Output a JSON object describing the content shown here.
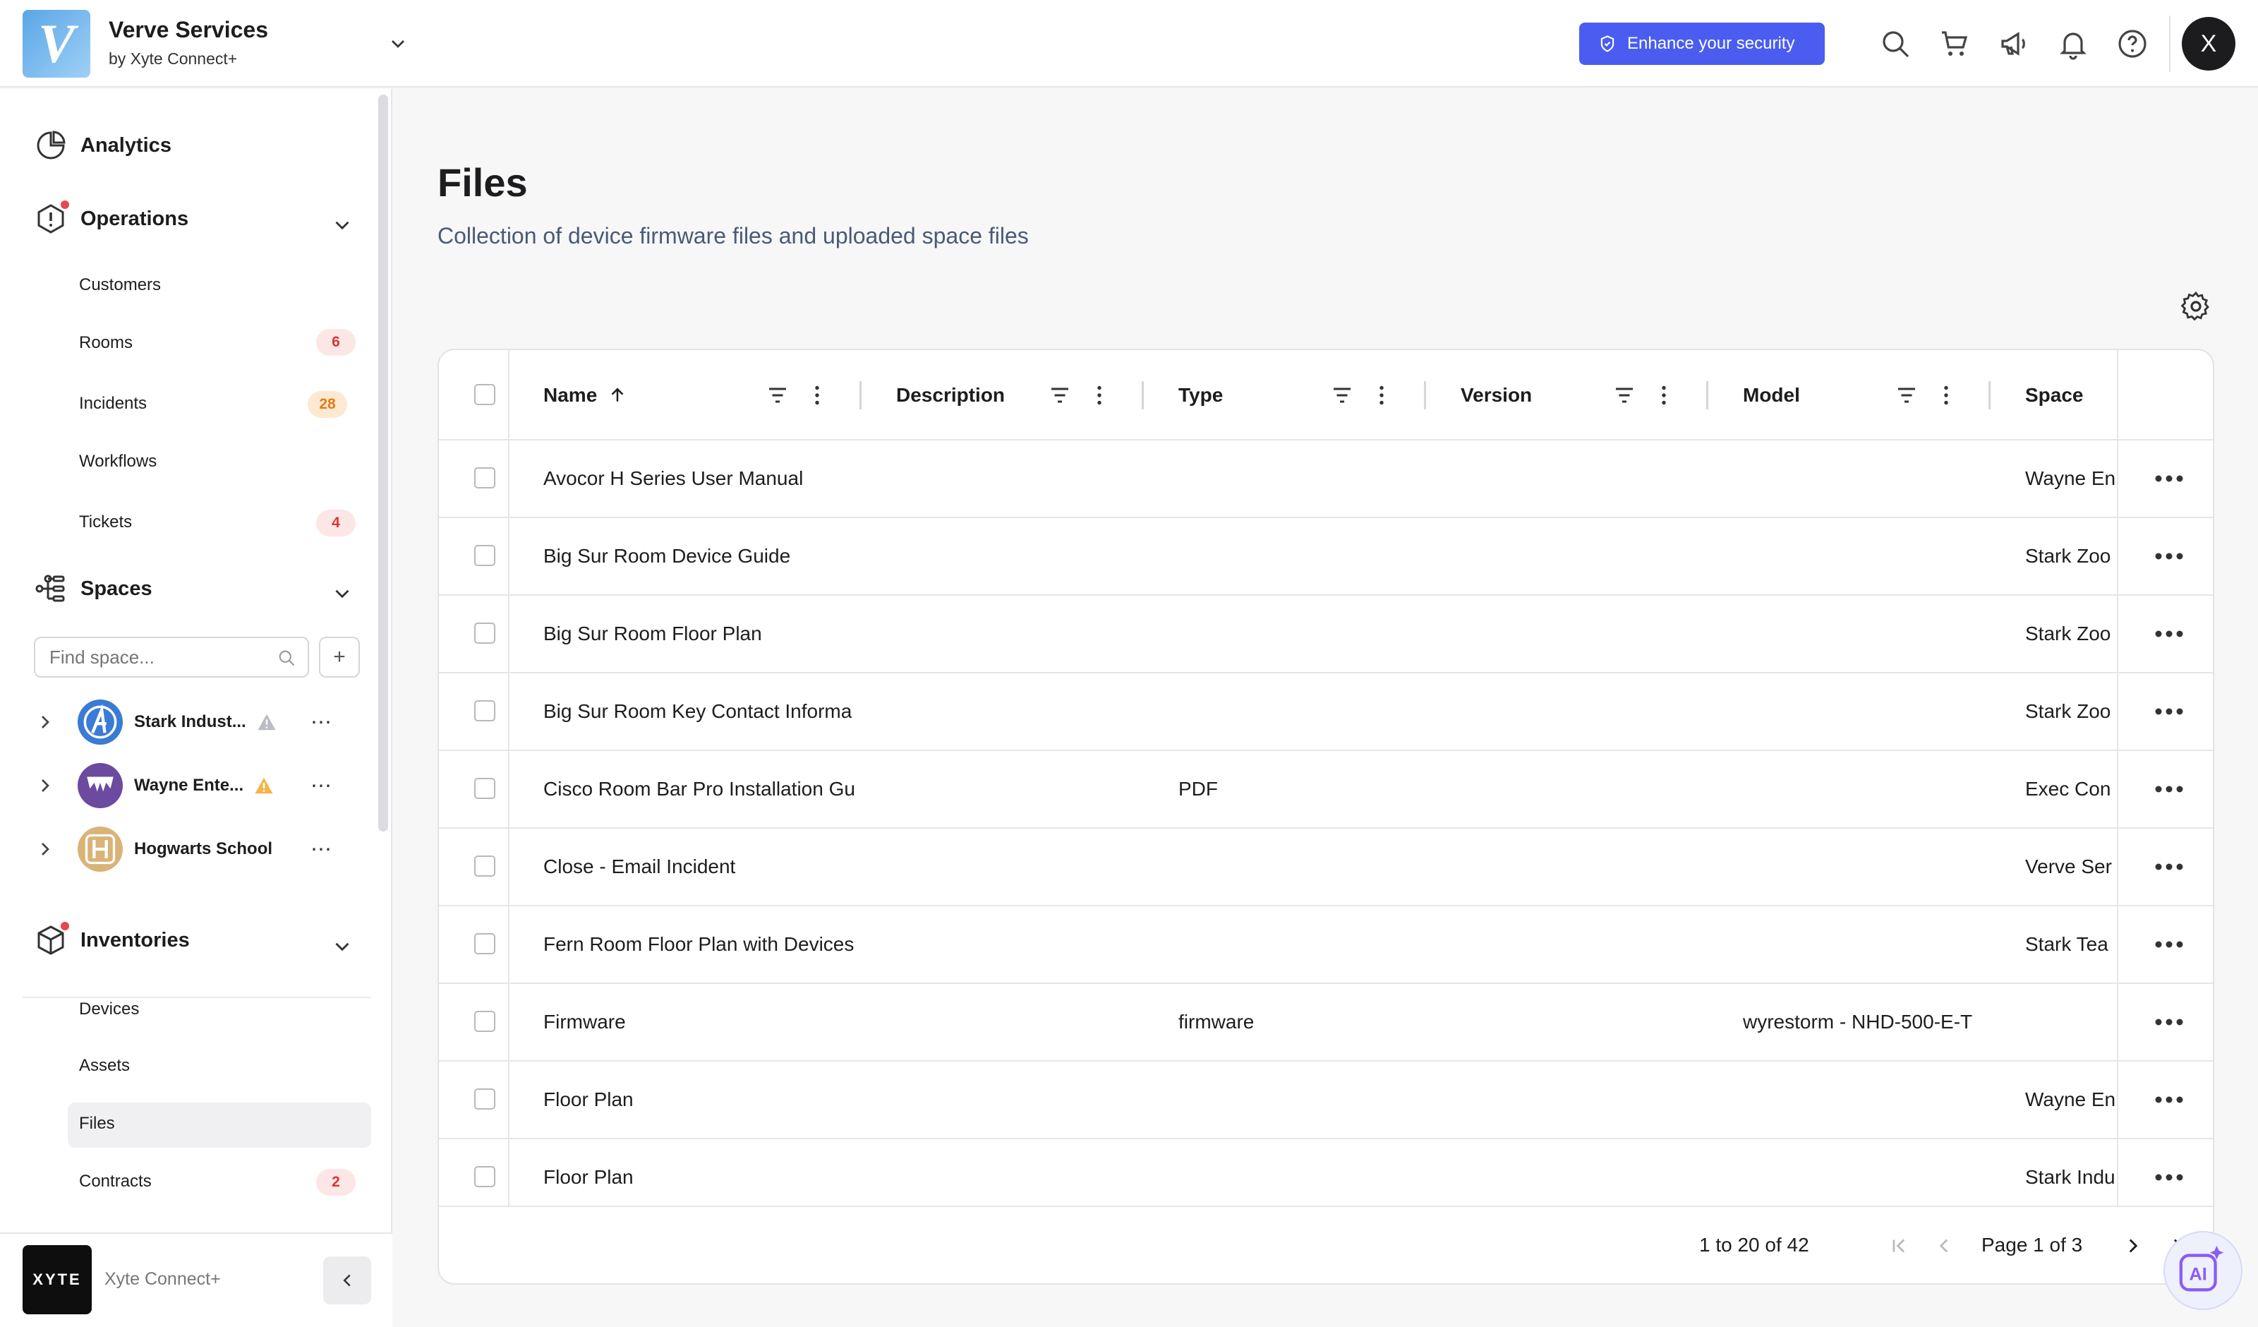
{
  "header": {
    "org_name": "Verve Services",
    "org_sub": "by Xyte Connect+",
    "logo_letter": "V",
    "enhance_label": "Enhance your security",
    "avatar_letter": "X",
    "accent_color": "#4a5df0"
  },
  "sidebar": {
    "analytics": "Analytics",
    "operations": "Operations",
    "operations_items": [
      {
        "label": "Customers",
        "badge": ""
      },
      {
        "label": "Rooms",
        "badge": "6"
      },
      {
        "label": "Incidents",
        "badge": "28"
      },
      {
        "label": "Workflows",
        "badge": ""
      },
      {
        "label": "Tickets",
        "badge": "4"
      }
    ],
    "spaces": "Spaces",
    "find_placeholder": "Find space...",
    "add_symbol": "+",
    "space_list": [
      {
        "name": "Stark Indust...",
        "icon": "avengers-logo",
        "warning": "gray"
      },
      {
        "name": "Wayne Ente...",
        "icon": "wayne-logo",
        "warning": "orange"
      },
      {
        "name": "Hogwarts School",
        "icon": "hogwarts-logo",
        "warning": ""
      }
    ],
    "inventories": "Inventories",
    "inventories_items": [
      {
        "label": "Devices",
        "badge": ""
      },
      {
        "label": "Assets",
        "badge": ""
      },
      {
        "label": "Files",
        "badge": ""
      },
      {
        "label": "Contracts",
        "badge": "2"
      }
    ],
    "footer_logo": "XYTE",
    "footer_name": "Xyte Connect+"
  },
  "main": {
    "title": "Files",
    "subtitle": "Collection of device firmware files and uploaded space files",
    "columns": [
      "Name",
      "Description",
      "Type",
      "Version",
      "Model",
      "Space"
    ],
    "rows": [
      {
        "name": "Avocor H Series User Manual",
        "description": "",
        "type": "",
        "version": "",
        "model": "",
        "space": "Wayne En"
      },
      {
        "name": "Big Sur Room Device Guide",
        "description": "",
        "type": "",
        "version": "",
        "model": "",
        "space": "Stark Zoo"
      },
      {
        "name": "Big Sur Room Floor Plan",
        "description": "",
        "type": "",
        "version": "",
        "model": "",
        "space": "Stark Zoo"
      },
      {
        "name": "Big Sur Room Key Contact Informa",
        "description": "",
        "type": "",
        "version": "",
        "model": "",
        "space": "Stark Zoo"
      },
      {
        "name": "Cisco Room Bar Pro Installation Gu",
        "description": "",
        "type": "PDF",
        "version": "",
        "model": "",
        "space": "Exec Con"
      },
      {
        "name": "Close - Email Incident",
        "description": "",
        "type": "",
        "version": "",
        "model": "",
        "space": "Verve Ser"
      },
      {
        "name": "Fern Room Floor Plan with Devices",
        "description": "",
        "type": "",
        "version": "",
        "model": "",
        "space": "Stark Tea"
      },
      {
        "name": "Firmware",
        "description": "",
        "type": "firmware",
        "version": "",
        "model": "wyrestorm - NHD-500-E-T",
        "space": ""
      },
      {
        "name": "Floor Plan",
        "description": "",
        "type": "",
        "version": "",
        "model": "",
        "space": "Wayne En"
      },
      {
        "name": "Floor Plan",
        "description": "",
        "type": "",
        "version": "",
        "model": "",
        "space": "Stark Indu"
      }
    ],
    "pagination": {
      "range": "1 to 20 of 42",
      "page": "Page 1 of 3"
    },
    "ai_label": "AI"
  }
}
